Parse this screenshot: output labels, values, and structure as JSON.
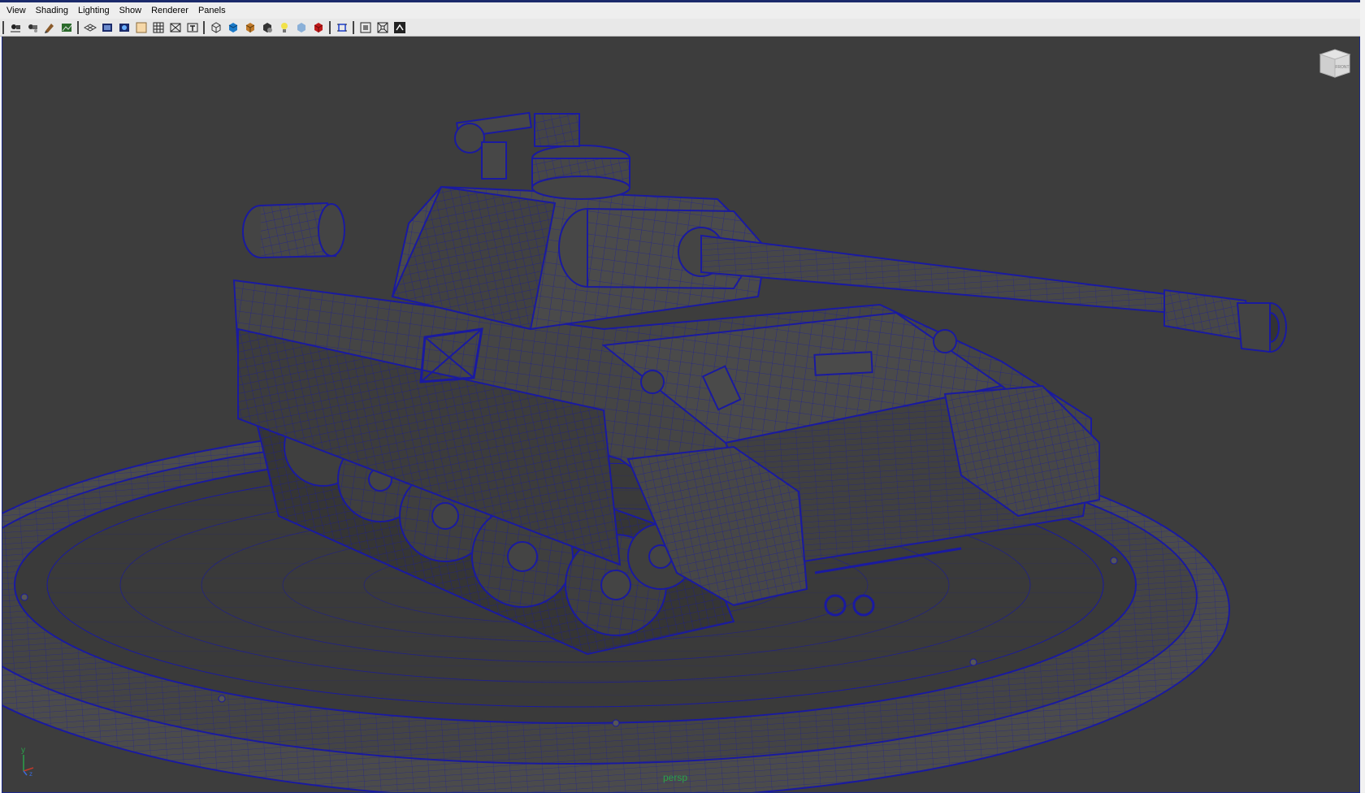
{
  "menu": {
    "items": [
      "View",
      "Shading",
      "Lighting",
      "Show",
      "Renderer",
      "Panels"
    ]
  },
  "toolbar": {
    "groups": [
      [
        "camera-select-icon",
        "camera-attributes-icon",
        "bookmark-icon",
        "image-plane-icon"
      ],
      [
        "grid-icon",
        "film-gate-icon",
        "resolution-gate-icon",
        "safe-action-icon",
        "wireframe-toggle-icon",
        "field-chart-icon",
        "safe-title-icon"
      ],
      [
        "wireframe-icon",
        "smooth-shade-icon",
        "textured-icon",
        "use-all-lights-icon",
        "default-light-icon",
        "shadows-icon",
        "xray-icon"
      ],
      [
        "isolate-select-icon"
      ],
      [
        "two-side-lighting-icon",
        "backface-culling-icon",
        "highlight-icon"
      ]
    ]
  },
  "viewport": {
    "camera_label": "persp",
    "viewcube_face": "FRONT",
    "axis": {
      "y": "y",
      "z": "z"
    },
    "colors": {
      "background": "#3d3d3d",
      "wireframe": "#1a1aa0",
      "mesh": "#4a4a4a",
      "camera_label": "#2aa04a"
    }
  }
}
